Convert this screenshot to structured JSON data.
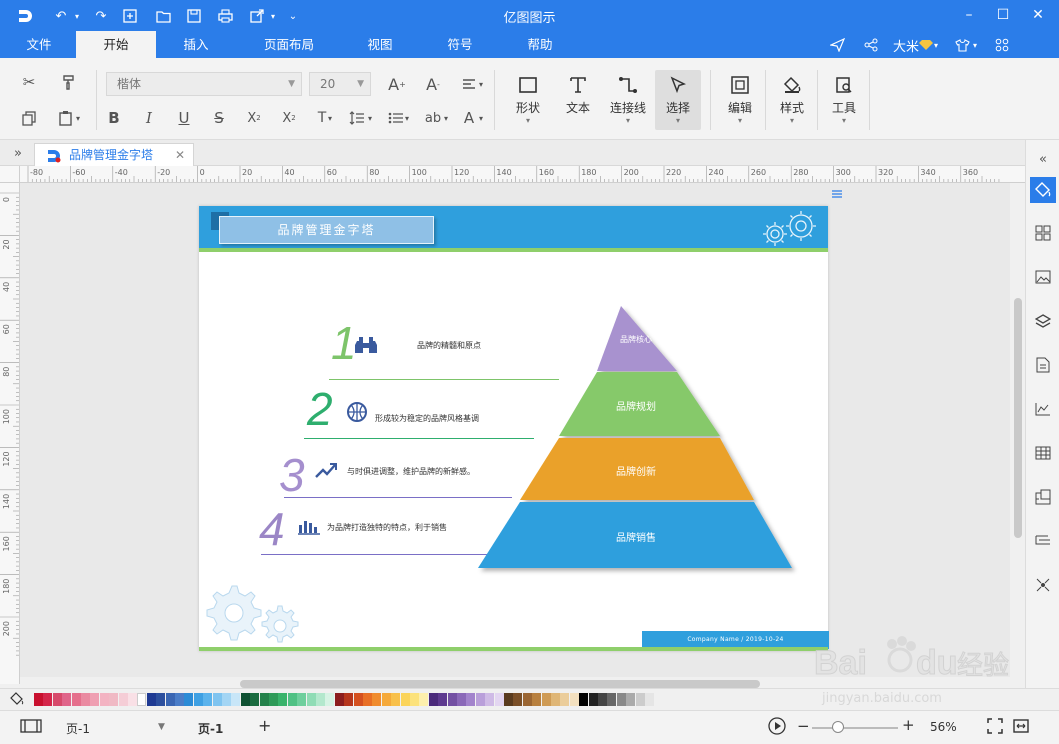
{
  "titlebar": {
    "title": "亿图图示"
  },
  "menu": {
    "tabs": [
      "文件",
      "开始",
      "插入",
      "页面布局",
      "视图",
      "符号",
      "帮助"
    ],
    "active": "开始",
    "user": "大米"
  },
  "ribbon": {
    "font_name": "楷体",
    "font_size": "20",
    "buttons": {
      "shape": "形状",
      "text": "文本",
      "connector": "连接线",
      "select": "选择",
      "edit": "编辑",
      "style": "样式",
      "tools": "工具"
    }
  },
  "document": {
    "tab_title": "品牌管理金字塔"
  },
  "rulers": {
    "h_labels": [
      "-80",
      "-60",
      "-40",
      "-20",
      "0",
      "20",
      "40",
      "60",
      "80",
      "100",
      "120",
      "140",
      "160",
      "180",
      "200",
      "220",
      "240",
      "260",
      "280",
      "300",
      "320",
      "340",
      "360"
    ],
    "v_labels": [
      "0",
      "20",
      "40",
      "60",
      "80",
      "100",
      "120",
      "140",
      "160",
      "180",
      "200"
    ]
  },
  "diagram": {
    "title": "品牌管理金字塔",
    "steps": [
      {
        "number": "1",
        "text": "品牌的精髓和原点",
        "color": "#7dc46a",
        "icon": "binoculars-icon"
      },
      {
        "number": "2",
        "text": "形成较为稳定的品牌风格基调",
        "color": "#2eae6e",
        "icon": "basketball-icon"
      },
      {
        "number": "3",
        "text": "与时俱进调整，维护品牌的新鲜感。",
        "color": "#a58fce",
        "icon": "trend-arrow-icon"
      },
      {
        "number": "4",
        "text": "为品牌打造独特的特点，利于销售",
        "color": "#9b86c6",
        "icon": "bar-chart-icon"
      }
    ],
    "pyramid": [
      {
        "label": "品牌核心",
        "color": "#a892cf"
      },
      {
        "label": "品牌规划",
        "color": "#86c96a"
      },
      {
        "label": "品牌创新",
        "color": "#eaa12a"
      },
      {
        "label": "品牌销售",
        "color": "#2f9fdd"
      }
    ],
    "footer": "Company Name  /  2019-10-24"
  },
  "palette": {
    "colors": [
      "#c8102e",
      "#d4264a",
      "#d74a6b",
      "#e0658a",
      "#e56f8c",
      "#ea8aa1",
      "#ef9fb2",
      "#f3b3c2",
      "#f0b9c4",
      "#f5cdd6",
      "#f9e0e6",
      "#ffffff",
      "#1f3a93",
      "#2c4f9e",
      "#3a66b3",
      "#4a7dc8",
      "#2b8bd6",
      "#3ea0e3",
      "#5bb3ec",
      "#7fc4f0",
      "#a3d5f4",
      "#c8e6f8",
      "#0f5132",
      "#1a6b3f",
      "#23814a",
      "#2e9a58",
      "#39b36b",
      "#4fc184",
      "#6ecf9d",
      "#8fdcb5",
      "#b3e8cd",
      "#d6f3e4",
      "#8b1e1e",
      "#b5361c",
      "#d4501f",
      "#e86f25",
      "#f08c2e",
      "#f5a93a",
      "#f8c04a",
      "#fbd45a",
      "#fce27c",
      "#fdefad",
      "#4b2a7b",
      "#5e3a8f",
      "#7350a3",
      "#8a68b8",
      "#a283cc",
      "#b99fda",
      "#cfbbe6",
      "#e3d6f1",
      "#5a3b1f",
      "#7a4f28",
      "#9b6633",
      "#b8803f",
      "#cf9b55",
      "#dfb676",
      "#ebcd9b",
      "#f3e0bf",
      "#000000",
      "#222222",
      "#444444",
      "#666666",
      "#888888",
      "#aaaaaa",
      "#cccccc",
      "#e5e5e5"
    ]
  },
  "status": {
    "page_selector": "页-1",
    "page_tab": "页-1",
    "zoom": "56%",
    "zoom_fraction": 0.3
  },
  "watermark": {
    "text": "Baidu经验",
    "sub": "jingyan.baidu.com"
  }
}
